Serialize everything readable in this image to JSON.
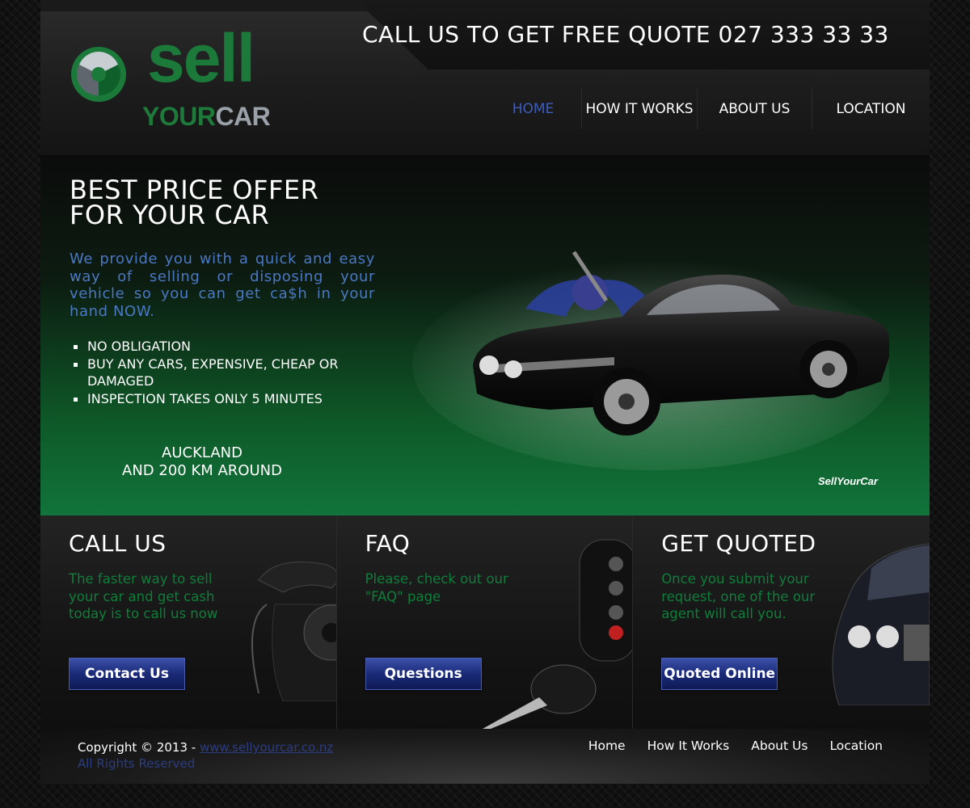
{
  "header": {
    "phone_cta": "CALL US TO GET FREE QUOTE 027 333 33 33",
    "logo": {
      "word1": "sell",
      "word2": "YOUR",
      "word3": "CAR"
    }
  },
  "nav": {
    "items": [
      {
        "label": "HOME",
        "active": true
      },
      {
        "label": "HOW IT WORKS",
        "active": false
      },
      {
        "label": "ABOUT US",
        "active": false
      },
      {
        "label": "LOCATION",
        "active": false
      }
    ]
  },
  "hero": {
    "title_line1": "BEST PRICE OFFER",
    "title_line2": "FOR YOUR CAR",
    "description": "We provide you with a quick and easy way of selling or disposing your vehicle so you can get ca$h in your hand NOW.",
    "bullets": [
      "NO OBLIGATION",
      "BUY ANY CARS, EXPENSIVE, CHEAP OR DAMAGED",
      "INSPECTION TAKES ONLY 5 MINUTES"
    ],
    "location_line1": "AUCKLAND",
    "location_line2": "AND 200 KM AROUND",
    "watermark": "SellYourCar"
  },
  "features": [
    {
      "title": "CALL US",
      "text": "The faster way to sell your car and get cash today is to call us now",
      "button": "Contact Us"
    },
    {
      "title": "FAQ",
      "text": "Please, check out our \"FAQ\" page",
      "button": "Questions"
    },
    {
      "title": "GET QUOTED",
      "text": "Once you submit your request, one of the our agent will call you.",
      "button": "Quoted Online"
    }
  ],
  "footer": {
    "copyright_prefix": "Copyright © 2013 - ",
    "site_link": "www.sellyourcar.co.nz",
    "rights": "All Rights Reserved",
    "links": [
      "Home",
      "How It Works",
      "About Us",
      "Location"
    ]
  },
  "colors": {
    "brand_green": "#1b7a3a",
    "nav_active_blue": "#3d5dbb",
    "button_blue": "#1a2a78",
    "feature_text_green": "#0f7e3a",
    "hero_desc_blue": "#4b78c2"
  }
}
